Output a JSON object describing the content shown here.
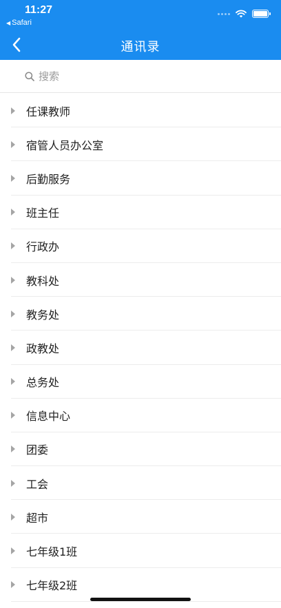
{
  "status_bar": {
    "time": "11:27",
    "back_app": "Safari"
  },
  "nav": {
    "title": "通讯录",
    "back_icon": "chevron-left-icon"
  },
  "search": {
    "placeholder": "搜索"
  },
  "groups": [
    {
      "label": "任课教师"
    },
    {
      "label": "宿管人员办公室"
    },
    {
      "label": "后勤服务"
    },
    {
      "label": "班主任"
    },
    {
      "label": "行政办"
    },
    {
      "label": "教科处"
    },
    {
      "label": "教务处"
    },
    {
      "label": "政教处"
    },
    {
      "label": "总务处"
    },
    {
      "label": "信息中心"
    },
    {
      "label": "团委"
    },
    {
      "label": "工会"
    },
    {
      "label": "超市"
    },
    {
      "label": "七年级1班"
    },
    {
      "label": "七年级2班"
    }
  ],
  "colors": {
    "header": "#1a8cf0",
    "arrow": "#a5a5a5"
  }
}
